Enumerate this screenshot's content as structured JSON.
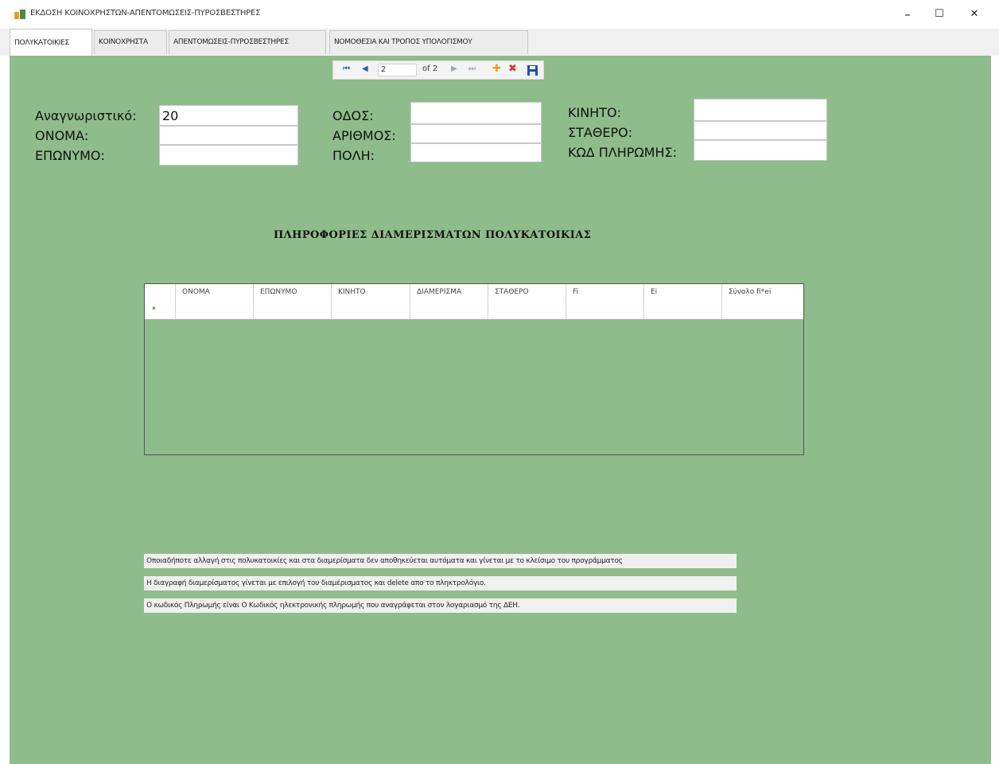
{
  "window": {
    "title": "ΕΚΔΟΣΗ ΚΟΙΝΟΧΡΗΣΤΩΝ-ΑΠΕΝΤΟΜΩΣΕΙΣ-ΠΥΡΟΣΒΕΣΤΗΡΕΣ",
    "minimize": "–",
    "maximize": "☐",
    "close": "✕"
  },
  "tabs": [
    {
      "label": "ΠΟΛΥΚΑΤΟΙΚΙΕΣ",
      "active": true
    },
    {
      "label": "ΚΟΙΝΟΧΡΗΣΤΑ",
      "active": false
    },
    {
      "label": "ΑΠΕΝΤΟΜΩΣΕΙΣ-ΠΥΡΟΣΒΕΣΤΗΡΕΣ",
      "active": false
    },
    {
      "label": "ΝΟΜΟΘΕΣΙΑ ΚΑΙ ΤΡΟΠΟΣ ΥΠΟΛΟΓΙΣΜΟΥ",
      "active": false
    }
  ],
  "navigator": {
    "first": "⏮",
    "prev": "◀",
    "position": "2",
    "count": "of 2",
    "next": "▶",
    "last": "⏭",
    "add": "✚",
    "delete": "✖",
    "save": "💾",
    "add_color": "#e8a020",
    "delete_color": "#d63a2a",
    "save_color": "#1f4fa8"
  },
  "form": {
    "id_label": "Αναγνωριστικό:",
    "id_value": "20",
    "name_label": "ΟΝΟΜΑ:",
    "name_value": "",
    "surname_label": "ΕΠΩΝΥΜΟ:",
    "surname_value": "",
    "street_label": "ΟΔΟΣ:",
    "street_value": "",
    "number_label": "ΑΡΙΘΜΟΣ:",
    "number_value": "",
    "city_label": "ΠΟΛΗ:",
    "city_value": "",
    "mobile_label": "ΚΙΝΗΤΟ:",
    "mobile_value": "",
    "landline_label": "ΣΤΑΘΕΡΟ:",
    "landline_value": "",
    "paycode_label": "ΚΩΔ ΠΛΗΡΩΜΗΣ:",
    "paycode_value": ""
  },
  "section_title": "ΠΛΗΡΟΦΟΡΙΕΣ ΔΙΑΜΕΡΙΣΜΑΤΩΝ ΠΟΛΥΚΑΤΟΙΚΙΑΣ",
  "grid": {
    "columns": [
      "ΟΝΟΜΑ",
      "ΕΠΩΝΥΜΟ",
      "ΚΙΝΗΤΟ",
      "ΔΙΑΜΕΡΙΣΜΑ",
      "ΣΤΑΘΕΡΟ",
      "Fi",
      "Ei",
      "Σύνολο fi*ei"
    ],
    "new_row_marker": "*"
  },
  "notes": [
    "Οποιαδήποτε αλλαγή  στις πολυκατοικίες και στα διαμερίσματα δεν αποθηκεύεται αυτόματα και γίνεται με το κλείσιμο του προγράμματος",
    "Η διαγραφή διαμερίσματος γίνεται με επιλογή του διαμέρισματος  και delete απο το πληκτρολόγιο.",
    "Ο κωδικός Πληρωμής είναι  Ο Κωδικός ηλεκτρονικής πληρωμής που αναγράφεται στον λογαριασμό της ΔΕΗ."
  ],
  "colors": {
    "background": "#8fbc8b",
    "app_icon": "#e89a2c"
  }
}
